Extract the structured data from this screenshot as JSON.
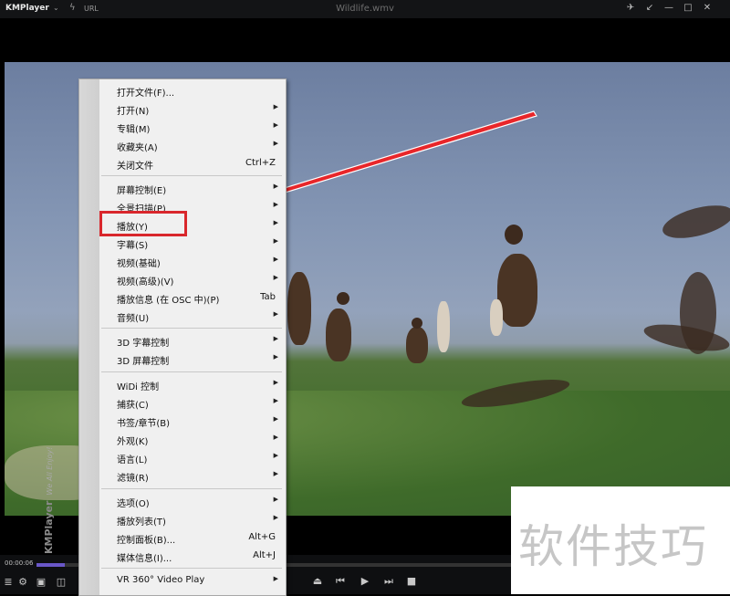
{
  "titlebar": {
    "app_name": "KMPlayer",
    "url_label": "URL",
    "window_title": "Wildlife.wmv",
    "icons": [
      "pin-icon",
      "minimize-to-tray-icon",
      "minimize-icon",
      "maximize-icon",
      "close-icon"
    ]
  },
  "playback": {
    "time": "00:00:06",
    "progress": 0.06
  },
  "menu": {
    "brand": "KMPlayer",
    "tagline": "We All Enjoy!",
    "items": [
      {
        "label": "打开文件(F)...",
        "shortcut": "",
        "submenu": false
      },
      {
        "label": "打开(N)",
        "shortcut": "",
        "submenu": true
      },
      {
        "label": "专辑(M)",
        "shortcut": "",
        "submenu": true
      },
      {
        "label": "收藏夹(A)",
        "shortcut": "",
        "submenu": true
      },
      {
        "label": "关闭文件",
        "shortcut": "Ctrl+Z",
        "submenu": false
      },
      {
        "label": "屏幕控制(E)",
        "shortcut": "",
        "submenu": true
      },
      {
        "label": "全景扫描(P)",
        "shortcut": "",
        "submenu": true
      },
      {
        "label": "播放(Y)",
        "shortcut": "",
        "submenu": true
      },
      {
        "label": "字幕(S)",
        "shortcut": "",
        "submenu": true
      },
      {
        "label": "视频(基础)",
        "shortcut": "",
        "submenu": true
      },
      {
        "label": "视频(高级)(V)",
        "shortcut": "",
        "submenu": true
      },
      {
        "label": "播放信息 (在 OSC 中)(P)",
        "shortcut": "Tab",
        "submenu": false
      },
      {
        "label": "音频(U)",
        "shortcut": "",
        "submenu": true
      },
      {
        "label": "3D 字幕控制",
        "shortcut": "",
        "submenu": true
      },
      {
        "label": "3D 屏幕控制",
        "shortcut": "",
        "submenu": true
      },
      {
        "label": "WiDi 控制",
        "shortcut": "",
        "submenu": true
      },
      {
        "label": "捕获(C)",
        "shortcut": "",
        "submenu": true
      },
      {
        "label": "书签/章节(B)",
        "shortcut": "",
        "submenu": true
      },
      {
        "label": "外观(K)",
        "shortcut": "",
        "submenu": true
      },
      {
        "label": "语言(L)",
        "shortcut": "",
        "submenu": true
      },
      {
        "label": "滤镜(R)",
        "shortcut": "",
        "submenu": true
      },
      {
        "label": "选项(O)",
        "shortcut": "",
        "submenu": true
      },
      {
        "label": "播放列表(T)",
        "shortcut": "",
        "submenu": true
      },
      {
        "label": "控制面板(B)...",
        "shortcut": "Alt+G",
        "submenu": false
      },
      {
        "label": "媒体信息(I)...",
        "shortcut": "Alt+J",
        "submenu": false
      },
      {
        "label": "VR 360° Video Play",
        "shortcut": "",
        "submenu": true
      }
    ],
    "highlighted_item": "播放(Y)"
  },
  "watermark": "软件技巧",
  "colors": {
    "highlight_box": "#d9272c",
    "progress_fill": "#6a57c8"
  }
}
